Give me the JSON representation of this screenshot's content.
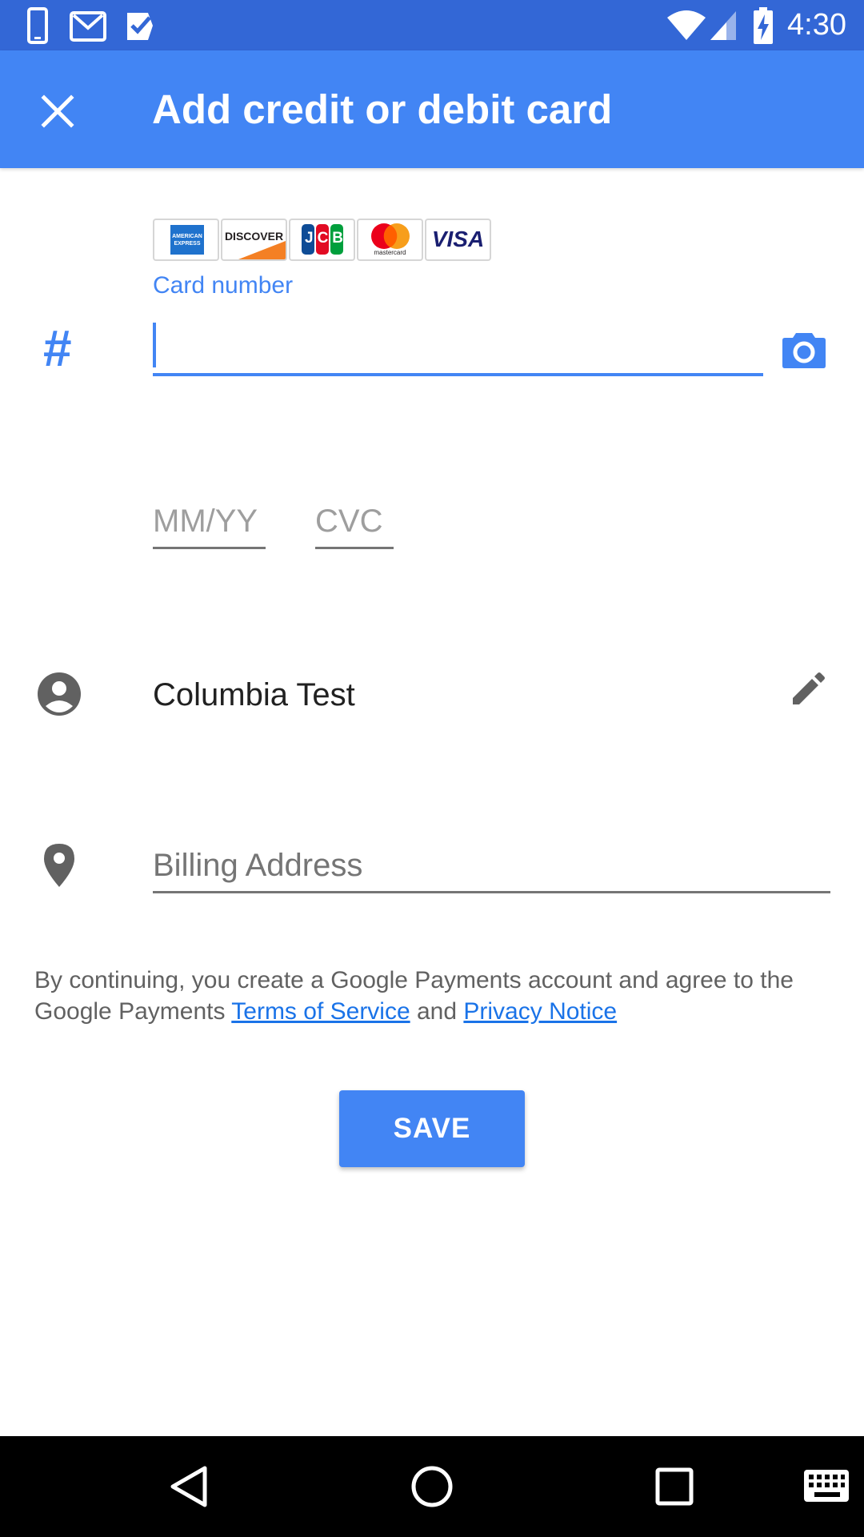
{
  "status_bar": {
    "time": "4:30",
    "left_icons": [
      "phone-icon",
      "gmail-icon",
      "tasks-icon"
    ],
    "right_icons": [
      "wifi-icon",
      "signal-icon",
      "battery-charging-icon"
    ]
  },
  "app_bar": {
    "title": "Add credit or debit card",
    "close_icon": "close-icon",
    "color": "#4285f4"
  },
  "card_form": {
    "accepted_cards": [
      "American Express",
      "Discover",
      "JCB",
      "Mastercard",
      "Visa"
    ],
    "amex_text": "AMERICAN EXPRESS",
    "discover_text": "DISCOVER",
    "jcb_text": "JCB",
    "mastercard_text": "mastercard",
    "visa_text": "VISA",
    "card_number_label": "Card number",
    "card_number_value": "",
    "hash_symbol": "#",
    "expiry_placeholder": "MM/YY",
    "cvc_placeholder": "CVC"
  },
  "cardholder": {
    "name": "Columbia Test"
  },
  "billing": {
    "placeholder": "Billing Address"
  },
  "legal": {
    "text_before": "By continuing, you create a Google Payments account and agree to the Google Payments ",
    "terms_link": "Terms of Service",
    "text_middle": " and ",
    "privacy_link": "Privacy Notice"
  },
  "save_button": {
    "label": "SAVE"
  },
  "nav_bar": {
    "buttons": [
      "back-icon",
      "home-icon",
      "recents-icon",
      "keyboard-icon"
    ]
  }
}
